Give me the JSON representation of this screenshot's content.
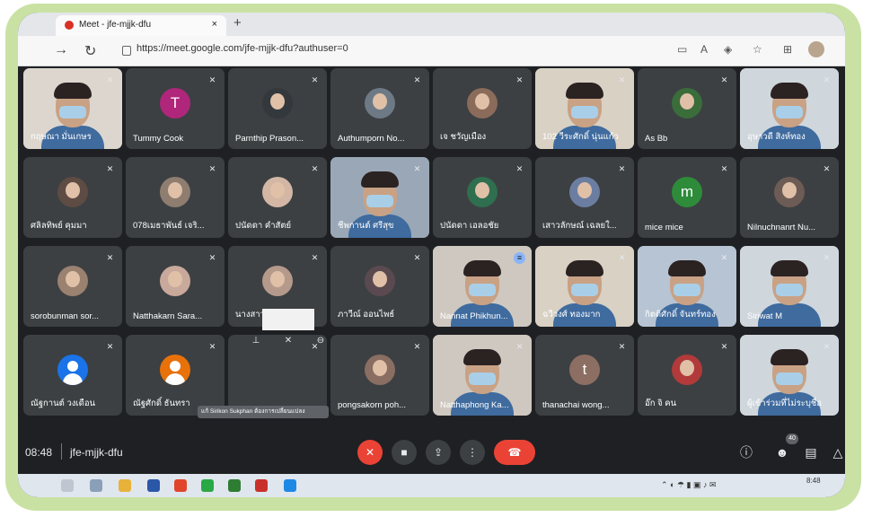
{
  "browser": {
    "tab_title": "Meet - jfe-mjjk-dfu",
    "url": "https://meet.google.com/jfe-mjjk-dfu?authuser=0"
  },
  "meeting": {
    "time": "08:48",
    "code": "jfe-mjjk-dfu",
    "participant_count": "40"
  },
  "tooltip": "แก้ Sirikon Sukphan ต้องการเปลี่ยนแปลง",
  "taskbar": {
    "clock": "8:48"
  },
  "participants": [
    {
      "name": "กฤษณา มั่นเกษร",
      "type": "video"
    },
    {
      "name": "Tummy Cook",
      "type": "letter",
      "initial": "T",
      "color": "#b0267b"
    },
    {
      "name": "Parnthip Prason...",
      "type": "photo",
      "color": "#33383c"
    },
    {
      "name": "Authumporn No...",
      "type": "photo",
      "color": "#6d7a86"
    },
    {
      "name": "เจ ชวัญเมือง",
      "type": "photo",
      "color": "#8b6b5a"
    },
    {
      "name": "102 วีระศักดิ์ นุ่นแก้ว",
      "type": "video"
    },
    {
      "name": "As Bb",
      "type": "photo",
      "color": "#3a6d3a"
    },
    {
      "name": "อุษาวดี สิงห์ทอง",
      "type": "video"
    },
    {
      "name": "ศลิลทิพย์ คุมมา",
      "type": "photo",
      "color": "#5e4b44"
    },
    {
      "name": "078เมธาพันธ์ เจริ...",
      "type": "photo",
      "color": "#8f7d70"
    },
    {
      "name": "ปนัดดา คำสัตย์",
      "type": "photo",
      "color": "#d3b7a4"
    },
    {
      "name": "ชีพกานต์ ศรีสุข",
      "type": "video"
    },
    {
      "name": "ปนัดดา เอลอชัย",
      "type": "photo",
      "color": "#2f6e4f"
    },
    {
      "name": "เสาวลักษณ์ เฉลยใ...",
      "type": "photo",
      "color": "#6b7ea1"
    },
    {
      "name": "mice mice",
      "type": "letter",
      "initial": "m",
      "color": "#2e8b3a"
    },
    {
      "name": "Nilnuchnanrt Nu...",
      "type": "photo",
      "color": "#6d5b55"
    },
    {
      "name": "sorobunman sor...",
      "type": "photo",
      "color": "#9a8170"
    },
    {
      "name": "Natthakarn Sara...",
      "type": "photo",
      "color": "#c9a99b"
    },
    {
      "name": "นางสาวสาวรีย์ ศรีสั...",
      "type": "photo",
      "color": "#b59a8c"
    },
    {
      "name": "ภาวีณ์ ออนไพธ์",
      "type": "photo",
      "color": "#5a4a4f"
    },
    {
      "name": "Nannat Phikhun...",
      "type": "video",
      "speaking": true
    },
    {
      "name": "ฉวีวงศ์ ทองมาก",
      "type": "video"
    },
    {
      "name": "กิตติศักดิ์ จันทร์ทอง",
      "type": "video"
    },
    {
      "name": "Siriwat M",
      "type": "video"
    },
    {
      "name": "ณัฐกานต์ วงเดือน",
      "type": "letter",
      "initial": "",
      "color": "#1a73e8"
    },
    {
      "name": "ณัฐศักดิ์ ธันทรา",
      "type": "letter",
      "initial": "",
      "color": "#e8710a"
    },
    {
      "name": "",
      "type": "presenting"
    },
    {
      "name": "pongsakorn poh...",
      "type": "photo",
      "color": "#8a6e62"
    },
    {
      "name": "Natthaphong Ka...",
      "type": "video"
    },
    {
      "name": "thanachai wong...",
      "type": "letter",
      "initial": "t",
      "color": "#8d6e63"
    },
    {
      "name": "อ๊ก จิ คน",
      "type": "photo",
      "color": "#b23a3a"
    },
    {
      "name": "ผู้เข้าร่วมที่ไม่ระบุชื่อ",
      "type": "video"
    }
  ]
}
